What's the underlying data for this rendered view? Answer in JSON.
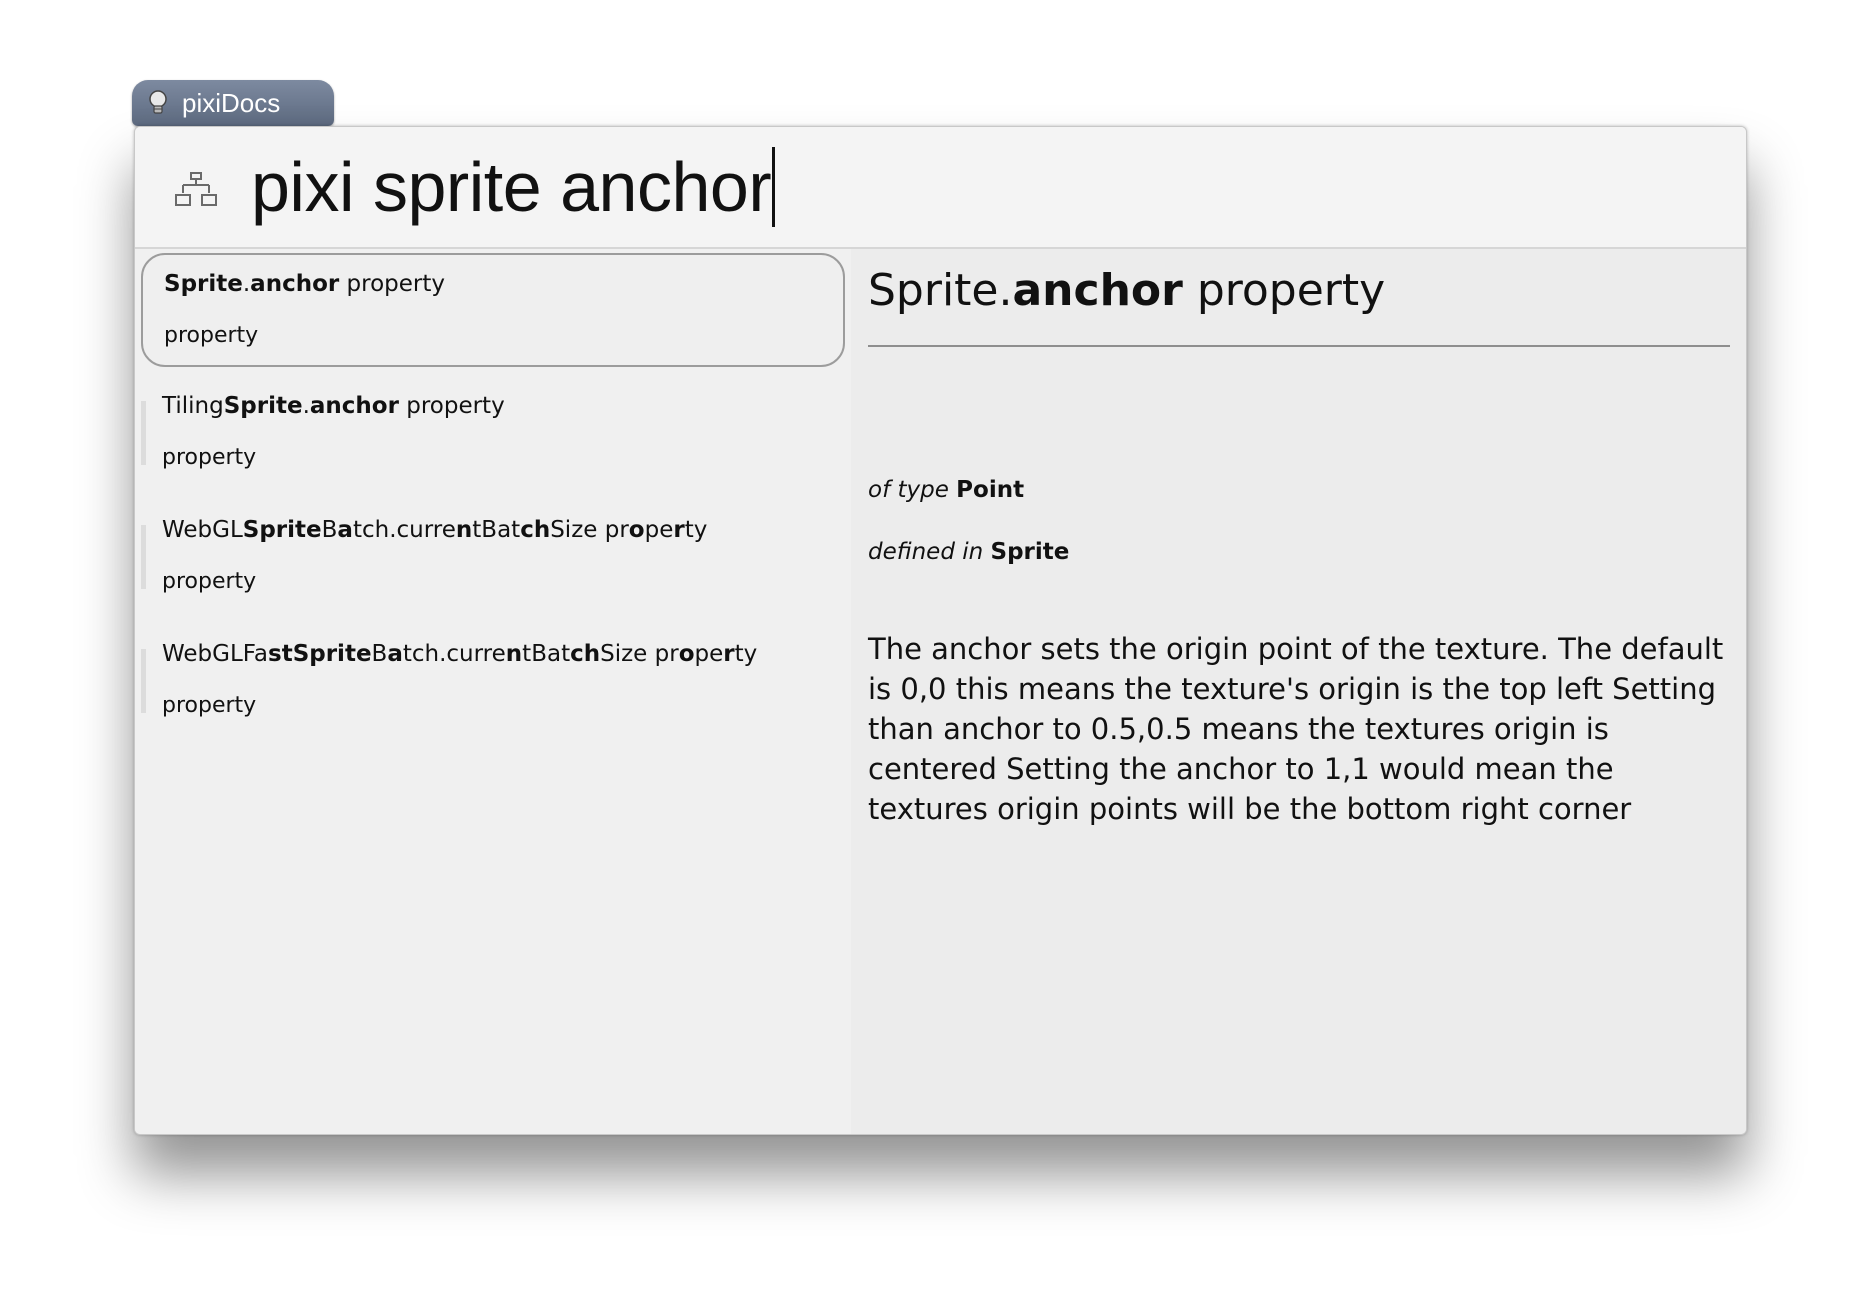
{
  "source_tab": {
    "label": "pixiDocs",
    "icon": "bulb-icon"
  },
  "search": {
    "app_icon": "hierarchy-icon",
    "query": "pixi sprite anchor"
  },
  "results": [
    {
      "title_parts": [
        {
          "text": "Sprite",
          "bold": true
        },
        {
          "text": ".",
          "bold": false
        },
        {
          "text": "anchor",
          "bold": true
        },
        {
          "text": " property",
          "bold": false
        }
      ],
      "subtitle": "property",
      "selected": true
    },
    {
      "title_parts": [
        {
          "text": "Tiling",
          "bold": false
        },
        {
          "text": "Sprite",
          "bold": true
        },
        {
          "text": ".",
          "bold": false
        },
        {
          "text": "anchor",
          "bold": true
        },
        {
          "text": " property",
          "bold": false
        }
      ],
      "subtitle": "property",
      "selected": false
    },
    {
      "title_parts": [
        {
          "text": "WebGL",
          "bold": false
        },
        {
          "text": "Sprite",
          "bold": true
        },
        {
          "text": "B",
          "bold": false
        },
        {
          "text": "a",
          "bold": true
        },
        {
          "text": "tch.curre",
          "bold": false
        },
        {
          "text": "n",
          "bold": true
        },
        {
          "text": "tBat",
          "bold": false
        },
        {
          "text": "ch",
          "bold": true
        },
        {
          "text": "Size pr",
          "bold": false
        },
        {
          "text": "o",
          "bold": true
        },
        {
          "text": "pe",
          "bold": false
        },
        {
          "text": "r",
          "bold": true
        },
        {
          "text": "ty",
          "bold": false
        }
      ],
      "subtitle": "property",
      "selected": false
    },
    {
      "title_parts": [
        {
          "text": "WebGLFa",
          "bold": false
        },
        {
          "text": "st",
          "bold": true
        },
        {
          "text": "Sprite",
          "bold": true
        },
        {
          "text": "B",
          "bold": false
        },
        {
          "text": "a",
          "bold": true
        },
        {
          "text": "tch.curre",
          "bold": false
        },
        {
          "text": "n",
          "bold": true
        },
        {
          "text": "tBat",
          "bold": false
        },
        {
          "text": "ch",
          "bold": true
        },
        {
          "text": "Size pr",
          "bold": false
        },
        {
          "text": "o",
          "bold": true
        },
        {
          "text": "pe",
          "bold": false
        },
        {
          "text": "r",
          "bold": true
        },
        {
          "text": "ty",
          "bold": false
        }
      ],
      "subtitle": "property",
      "selected": false
    }
  ],
  "detail": {
    "title_prefix": "Sprite.",
    "title_bold": "anchor",
    "title_suffix": " property",
    "type_label": "of type",
    "type_value": "Point",
    "defined_label": "defined in",
    "defined_value": "Sprite",
    "description": "The anchor sets the origin point of the texture. The default is 0,0 this means the texture's origin is the top left Setting than anchor to 0.5,0.5 means the textures origin is centered Setting the anchor to 1,1 would mean the textures origin points will be the bottom right corner"
  }
}
